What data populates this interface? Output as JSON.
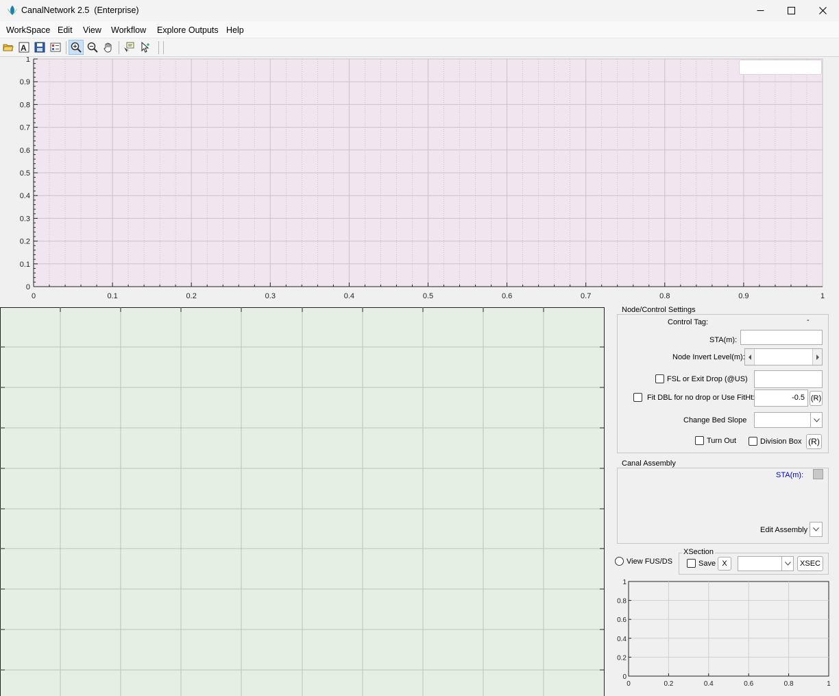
{
  "window": {
    "title": "CanalNetwork 2.5  (Enterprise)",
    "controls": {
      "minimize": "minimize-icon",
      "maximize": "maximize-icon",
      "close": "close-icon"
    }
  },
  "menu": [
    "WorkSpace",
    "Edit",
    "View",
    "Workflow",
    "Explore Outputs",
    "Help"
  ],
  "toolbar": {
    "icons": [
      "open-folder-icon",
      "text-font-icon",
      "save-icon",
      "properties-icon",
      "zoom-in-icon",
      "zoom-out-icon",
      "pan-hand-icon",
      "data-cursor-icon",
      "select-pointer-icon"
    ],
    "active": "zoom-in-icon"
  },
  "profile_plot": {
    "background": "#f1e5f0",
    "x_ticks": [
      "0",
      "0.1",
      "0.2",
      "0.3",
      "0.4",
      "0.5",
      "0.6",
      "0.7",
      "0.8",
      "0.9",
      "1"
    ],
    "y_ticks": [
      "0",
      "0.1",
      "0.2",
      "0.3",
      "0.4",
      "0.5",
      "0.6",
      "0.7",
      "0.8",
      "0.9",
      "1"
    ],
    "legend_value": ""
  },
  "plan_plot": {
    "background": "#e6efe3"
  },
  "node_settings": {
    "title": "Node/Control Settings",
    "control_tag_label": "Control Tag:",
    "control_tag_value": "-",
    "sta_label": "STA(m):",
    "sta_value": "",
    "invert_label": "Node Invert Level(m):",
    "invert_value": "",
    "fsl_label": "FSL or Exit Drop (@US)",
    "fsl_value": "",
    "fit_dbl_label": "Fit DBL for no drop or Use FitHt:",
    "fit_dbl_value": "-0.5",
    "fit_dbl_button": "(R)",
    "bed_slope_label": "Change Bed Slope",
    "bed_slope_value": "",
    "turn_out_label": "Turn Out",
    "division_box_label": "Division Box",
    "division_button": "(R)"
  },
  "canal_assembly": {
    "title": "Canal Assembly",
    "sta_label": "STA(m):",
    "edit_label": "Edit Assembly"
  },
  "view_fus": {
    "label": "View FUS/DS"
  },
  "xsection": {
    "title": "XSection",
    "save_label": "Save",
    "x_button": "X",
    "dropdown_value": "",
    "xsec_button": "XSEC"
  },
  "mini_plot": {
    "x_ticks": [
      "0",
      "0.2",
      "0.4",
      "0.6",
      "0.8",
      "1"
    ],
    "y_ticks": [
      "0",
      "0.2",
      "0.4",
      "0.6",
      "0.8",
      "1"
    ]
  },
  "colors": {
    "profile_bg": "#f1e5f0",
    "plan_bg": "#e6efe3",
    "mini_bg": "#f0f0f0",
    "link_blue": "#0000c8"
  }
}
